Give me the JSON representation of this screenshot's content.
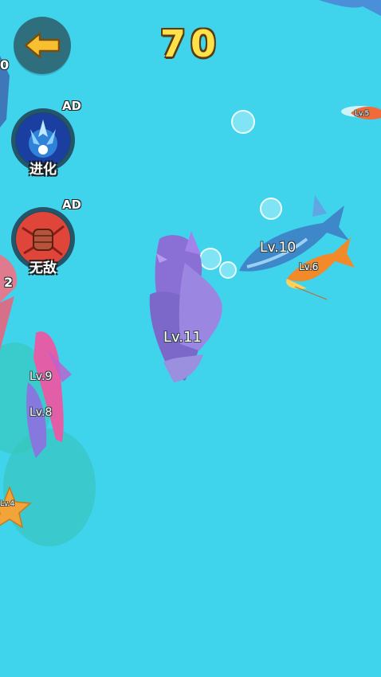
{
  "hud": {
    "score": "70",
    "back_icon": "arrow-left-icon",
    "powerups": [
      {
        "label": "进化",
        "ad_badge": "AD",
        "icon": "evolve-icon"
      },
      {
        "label": "无敌",
        "ad_badge": "AD",
        "icon": "invincible-fist-icon"
      }
    ]
  },
  "fish": {
    "player_level": "Lv.11",
    "shark_level": "Lv.10",
    "goldfish_level": "Lv.6",
    "pink_fish_level": "Lv.9",
    "purple_fish_level": "Lv.8",
    "small_fish_level": "Lv.5",
    "starfish_level": "Lv.4"
  },
  "edge_counts": {
    "left_top": "0",
    "left_mid": "2"
  },
  "colors": {
    "water": "#3fd3ec",
    "score_fill": "#ffe24a",
    "back_button": "#2f6f7d"
  }
}
